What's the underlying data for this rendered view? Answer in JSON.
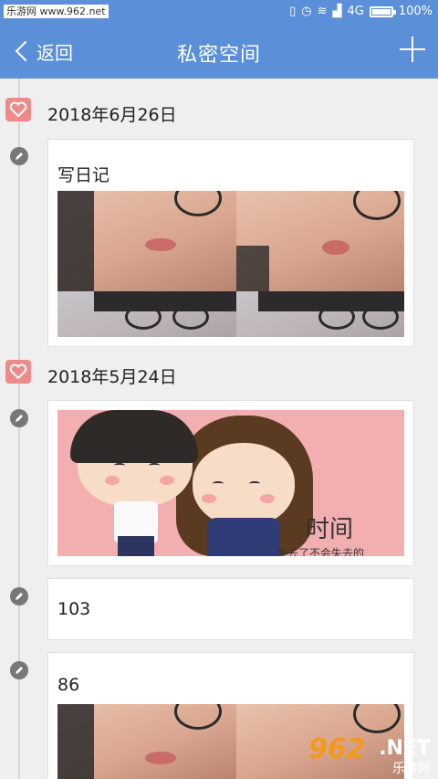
{
  "status_bar": {
    "watermark": "乐游网 www.962.net",
    "network": "4G",
    "battery": "100%"
  },
  "header": {
    "back_label": "返回",
    "title": "私密空间"
  },
  "entries": [
    {
      "date": "2018年6月26日",
      "text": "写日记"
    },
    {
      "date": "2018年5月24日",
      "cartoon_caption": "时间",
      "cartoon_subtext": "失去了不会失去的"
    },
    {
      "text": "103"
    },
    {
      "text": "86"
    }
  ],
  "watermark_logo": {
    "brand": "962",
    "domain": ".NET",
    "name": "乐游网"
  },
  "colors": {
    "accent": "#5b8fd8",
    "heart": "#ef8a8a",
    "background": "#efefef"
  }
}
